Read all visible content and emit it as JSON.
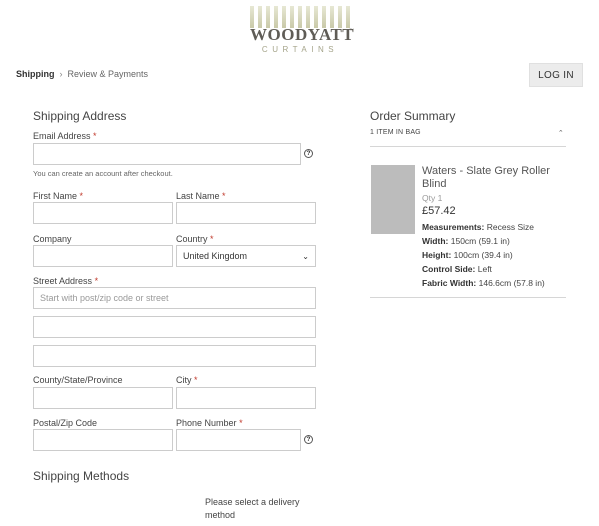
{
  "brand": {
    "name": "WOODYATT",
    "sub": "CURTAINS",
    "tm": "™"
  },
  "progress": {
    "step1": "Shipping",
    "separator": "›",
    "step2": "Review & Payments"
  },
  "header": {
    "login_label": "LOG IN"
  },
  "shipping": {
    "title": "Shipping Address",
    "email_label": "Email Address",
    "email_note": "You can create an account after checkout.",
    "first_name_label": "First Name",
    "last_name_label": "Last Name",
    "company_label": "Company",
    "country_label": "Country",
    "country_value": "United Kingdom",
    "street_label": "Street Address",
    "street_placeholder": "Start with post/zip code or street",
    "county_label": "County/State/Province",
    "city_label": "City",
    "postal_label": "Postal/Zip Code",
    "phone_label": "Phone Number",
    "required_mark": "*",
    "help_glyph": "?"
  },
  "shipping_methods": {
    "title": "Shipping Methods",
    "message": "Please select a delivery method"
  },
  "order_summary": {
    "title": "Order Summary",
    "items_count": "1 ITEM IN BAG",
    "product": {
      "name": "Waters - Slate Grey Roller Blind",
      "qty_label": "Qty",
      "qty": "1",
      "price": "£57.42",
      "options": [
        {
          "label": "Measurements:",
          "value": "Recess Size"
        },
        {
          "label": "Width:",
          "value": "150cm (59.1 in)"
        },
        {
          "label": "Height:",
          "value": "100cm (39.4 in)"
        },
        {
          "label": "Control Side:",
          "value": "Left"
        },
        {
          "label": "Fabric Width:",
          "value": "146.6cm (57.8 in)"
        }
      ]
    }
  },
  "colors": {
    "required": "#c0392b",
    "thumb": "#bcbcbc",
    "login_bg": "#ececec"
  }
}
